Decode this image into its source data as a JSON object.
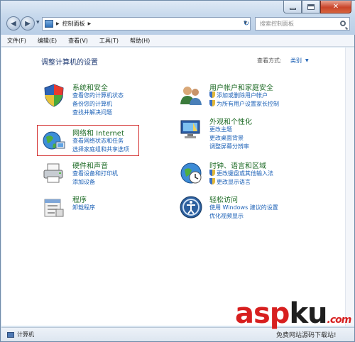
{
  "window": {
    "address": {
      "root_label": "控制面板",
      "search_placeholder": "搜索控制面板"
    }
  },
  "menubar": {
    "items": [
      "文件(F)",
      "编辑(E)",
      "查看(V)",
      "工具(T)",
      "帮助(H)"
    ]
  },
  "content": {
    "heading": "调整计算机的设置",
    "view_by_label": "查看方式:",
    "view_by_value": "类别",
    "categories": [
      {
        "title": "系统和安全",
        "links": [
          {
            "text": "查看您的计算机状态",
            "shield": false
          },
          {
            "text": "备份您的计算机",
            "shield": false
          },
          {
            "text": "查找并解决问题",
            "shield": false
          }
        ]
      },
      {
        "title": "网络和 Internet",
        "links": [
          {
            "text": "查看网络状态和任务",
            "shield": false
          },
          {
            "text": "选择家庭组和共享选项",
            "shield": false
          }
        ]
      },
      {
        "title": "硬件和声音",
        "links": [
          {
            "text": "查看设备和打印机",
            "shield": false
          },
          {
            "text": "添加设备",
            "shield": false
          }
        ]
      },
      {
        "title": "程序",
        "links": [
          {
            "text": "卸载程序",
            "shield": false
          }
        ]
      },
      {
        "title": "用户帐户和家庭安全",
        "links": [
          {
            "text": "添加或删除用户帐户",
            "shield": true
          },
          {
            "text": "为所有用户设置家长控制",
            "shield": true
          }
        ]
      },
      {
        "title": "外观和个性化",
        "links": [
          {
            "text": "更改主题",
            "shield": false
          },
          {
            "text": "更改桌面背景",
            "shield": false
          },
          {
            "text": "调整屏幕分辨率",
            "shield": false
          }
        ]
      },
      {
        "title": "时钟、语言和区域",
        "links": [
          {
            "text": "更改键盘或其他输入法",
            "shield": true
          },
          {
            "text": "更改显示语言",
            "shield": true
          }
        ]
      },
      {
        "title": "轻松访问",
        "links": [
          {
            "text": "使用 Windows 建议的设置",
            "shield": false
          },
          {
            "text": "优化视频显示",
            "shield": false
          }
        ]
      }
    ]
  },
  "statusbar": {
    "text": "计算机"
  },
  "watermark": {
    "brand_a": "asp",
    "brand_b": "ku",
    "brand_c": ".com",
    "tagline": "免费网站源码下载站!"
  },
  "colors": {
    "highlight": "#d32d2d",
    "category_title": "#1e6b26",
    "link": "#1d62b7",
    "heading": "#1e3a73"
  }
}
